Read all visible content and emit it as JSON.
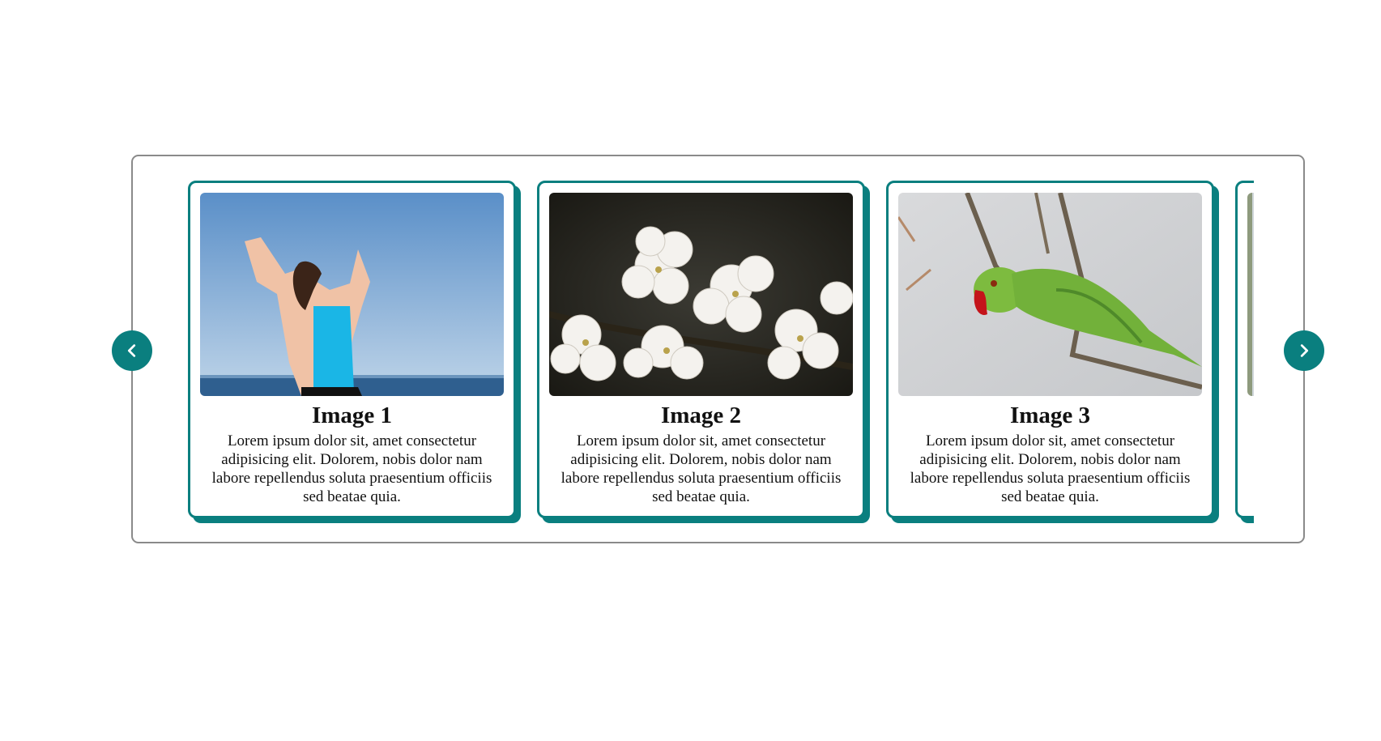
{
  "carousel": {
    "prev_icon": "chevron-left-icon",
    "next_icon": "chevron-right-icon",
    "accent_color": "#0a7f7f",
    "cards": [
      {
        "title": "Image 1",
        "text": "Lorem ipsum dolor sit, amet consectetur adipisicing elit. Dolorem, nobis dolor nam labore repellendus soluta praesentium officiis sed beatae quia.",
        "image": "woman-beach-photo"
      },
      {
        "title": "Image 2",
        "text": "Lorem ipsum dolor sit, amet consectetur adipisicing elit. Dolorem, nobis dolor nam labore repellendus soluta praesentium officiis sed beatae quia.",
        "image": "white-blossom-photo"
      },
      {
        "title": "Image 3",
        "text": "Lorem ipsum dolor sit, amet consectetur adipisicing elit. Dolorem, nobis dolor nam labore repellendus soluta praesentium officiis sed beatae quia.",
        "image": "green-parrot-photo"
      },
      {
        "title": "",
        "text": "",
        "image": "partially-visible-photo"
      }
    ]
  }
}
